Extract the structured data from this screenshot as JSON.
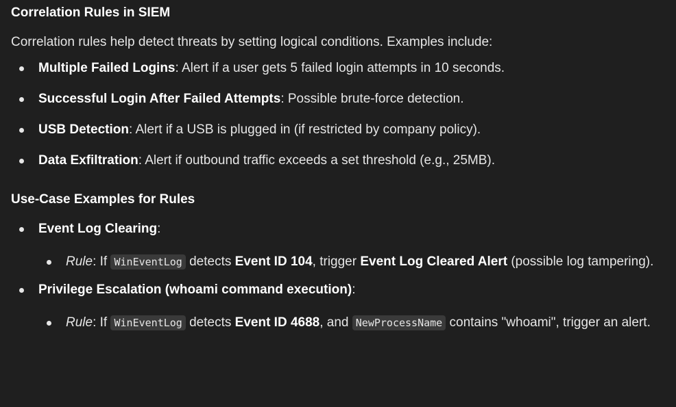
{
  "section1": {
    "heading": "Correlation Rules in SIEM",
    "intro": "Correlation rules help detect threats by setting logical conditions. Examples include:",
    "items": [
      {
        "term": "Multiple Failed Logins",
        "desc": ": Alert if a user gets 5 failed login attempts in 10 seconds."
      },
      {
        "term": "Successful Login After Failed Attempts",
        "desc": ": Possible brute-force detection."
      },
      {
        "term": "USB Detection",
        "desc": ": Alert if a USB is plugged in (if restricted by company policy)."
      },
      {
        "term": "Data Exfiltration",
        "desc": ": Alert if outbound traffic exceeds a set threshold (e.g., 25MB)."
      }
    ]
  },
  "section2": {
    "heading": "Use-Case Examples for Rules",
    "items": [
      {
        "term": "Event Log Clearing",
        "term_suffix": ":",
        "rule": {
          "label": "Rule",
          "t1": ": If ",
          "code1": "WinEventLog",
          "t2": " detects ",
          "b1": "Event ID 104",
          "t3": ", trigger ",
          "b2": "Event Log Cleared Alert",
          "t4": " (possible log tampering)."
        }
      },
      {
        "term": "Privilege Escalation (whoami command execution)",
        "term_suffix": ":",
        "rule": {
          "label": "Rule",
          "t1": ": If ",
          "code1": "WinEventLog",
          "t2": " detects ",
          "b1": "Event ID 4688",
          "t3": ", and ",
          "code2": "NewProcessName",
          "t4": " contains \"whoami\", trigger an alert."
        }
      }
    ]
  }
}
